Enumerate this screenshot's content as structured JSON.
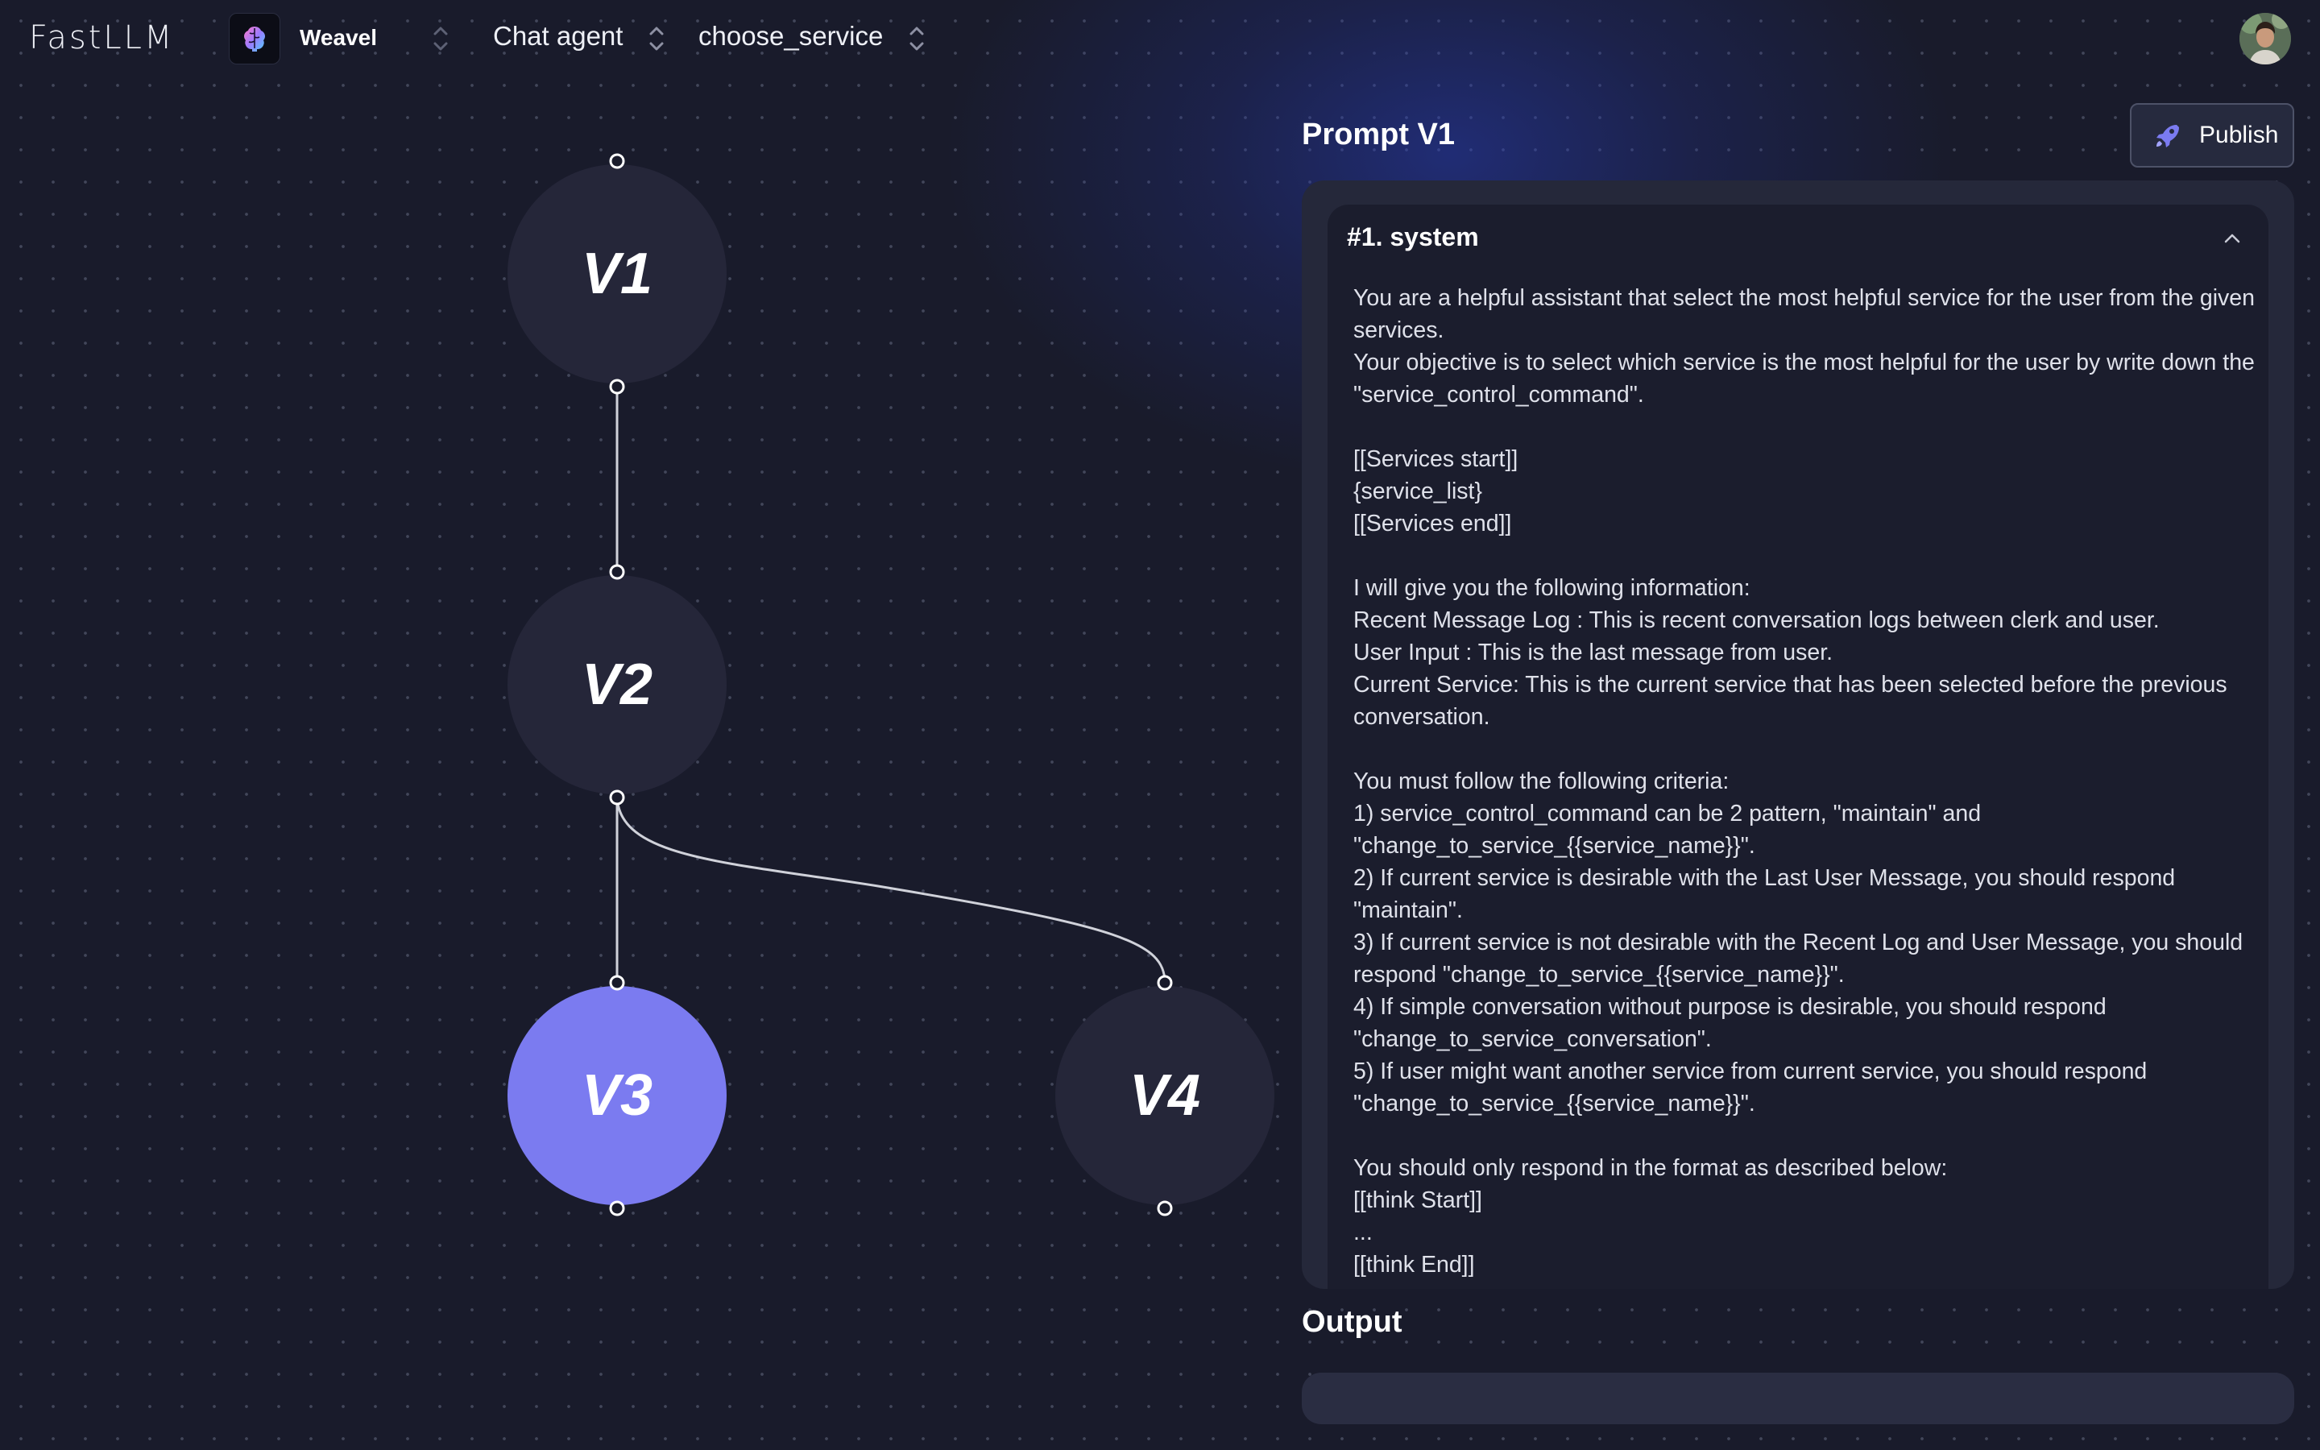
{
  "app": {
    "logo": "FastLLM"
  },
  "header": {
    "workspace": {
      "name": "Weavel",
      "icon": "brain-icon"
    },
    "project_selector": {
      "label": "Chat agent"
    },
    "module_selector": {
      "label": "choose_service"
    },
    "user_avatar": "user-avatar"
  },
  "graph": {
    "nodes": [
      {
        "id": "v1",
        "label": "V1",
        "selected": false
      },
      {
        "id": "v2",
        "label": "V2",
        "selected": false
      },
      {
        "id": "v3",
        "label": "V3",
        "selected": true
      },
      {
        "id": "v4",
        "label": "V4",
        "selected": false
      }
    ],
    "edges": [
      {
        "from": "V1",
        "to": "V2"
      },
      {
        "from": "V2",
        "to": "V3"
      },
      {
        "from": "V2",
        "to": "V4"
      }
    ],
    "colors": {
      "node": "#252639",
      "selected": "#7b7bf0",
      "edge": "#d0d2da"
    }
  },
  "prompt": {
    "title": "Prompt V1",
    "publish_label": "Publish",
    "messages": [
      {
        "role_label": "#1. system",
        "content": "You are a helpful assistant that select the most helpful service for the user from the given services.\nYour objective is to select which service is the most helpful for the user by write down the \"service_control_command\".\n\n[[Services start]]\n{service_list}\n[[Services end]]\n\nI will give you the following information:\nRecent Message Log : This is recent conversation logs between clerk and user.\nUser Input : This is the last message from user.\nCurrent Service: This is the current service that has been selected before the previous conversation.\n\nYou must follow the following criteria:\n1) service_control_command can be 2 pattern, \"maintain\" and \"change_to_service_{{service_name}}\".\n2) If current service is desirable with the Last User Message, you should respond \"maintain\".\n3) If current service is not desirable with the Recent Log and User Message, you should respond \"change_to_service_{{service_name}}\".\n4) If simple conversation without purpose is desirable, you should respond \"change_to_service_conversation\".\n5) If user might want another service from current service, you should respond \"change_to_service_{{service_name}}\".\n\nYou should only respond in the format as described below:\n[[think Start]]\n...\n[[think End]]"
      }
    ]
  },
  "output": {
    "title": "Output",
    "value": ""
  },
  "colors": {
    "background": "#191b2b",
    "accent": "#7b7bf0",
    "panel": "#25283a"
  }
}
